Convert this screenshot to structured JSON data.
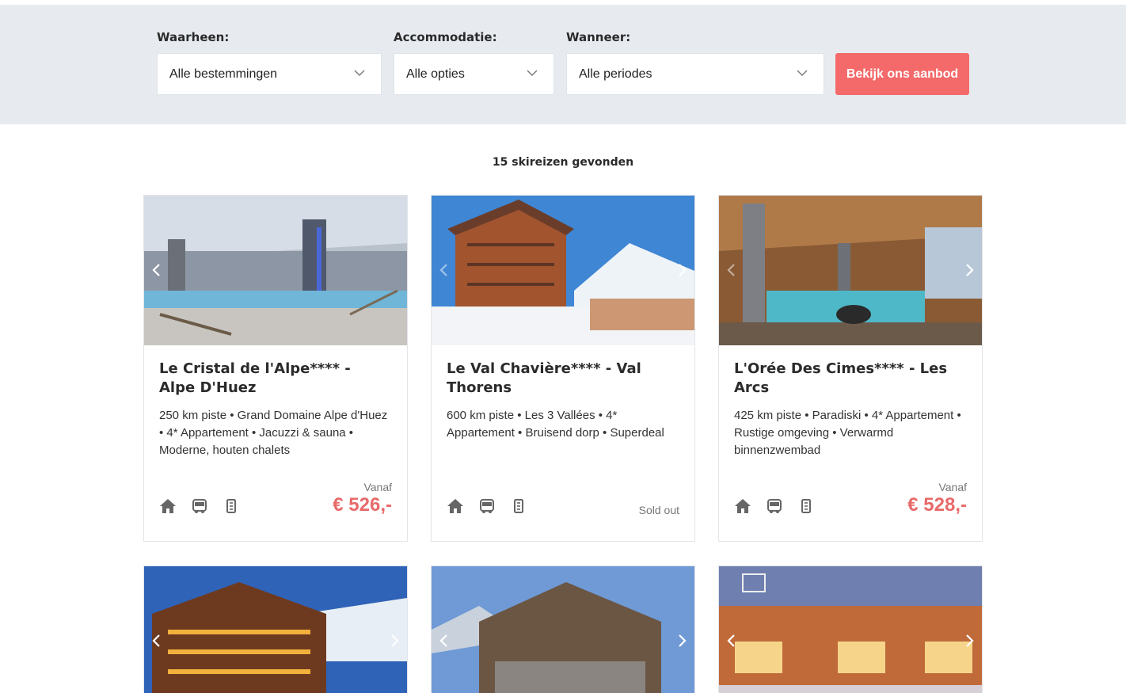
{
  "search": {
    "where_label": "Waarheen:",
    "where_value": "Alle bestemmingen",
    "accommodation_label": "Accommodatie:",
    "accommodation_value": "Alle opties",
    "when_label": "Wanneer:",
    "when_value": "Alle periodes",
    "cta_label": "Bekijk ons aanbod"
  },
  "results_count": "15 skireizen gevonden",
  "colors": {
    "accent": "#f46a6a",
    "price": "#e86a6a",
    "searchbar_bg": "#e7ebf0"
  },
  "icons": [
    "home-icon",
    "bus-icon",
    "skipass-icon",
    "chevron-down-icon",
    "chevron-left-icon",
    "chevron-right-icon"
  ],
  "cards": [
    {
      "title": "Le Cristal de l'Alpe**** - Alpe D'Huez",
      "description": "250 km piste • Grand Domaine Alpe d'Huez • 4* Appartement • Jacuzzi & sauna • Moderne, houten chalets",
      "from_label": "Vanaf",
      "price": "€ 526,-",
      "status": ""
    },
    {
      "title": "Le Val Chavière**** - Val Thorens",
      "description": "600 km piste • Les 3 Vallées • 4* Appartement • Bruisend dorp • Superdeal",
      "from_label": "",
      "price": "",
      "status": "Sold out"
    },
    {
      "title": "L'Orée Des Cimes**** - Les Arcs",
      "description": "425 km piste • Paradiski • 4* Appartement • Rustige omgeving • Verwarmd binnenzwembad",
      "from_label": "Vanaf",
      "price": "€ 528,-",
      "status": ""
    }
  ]
}
